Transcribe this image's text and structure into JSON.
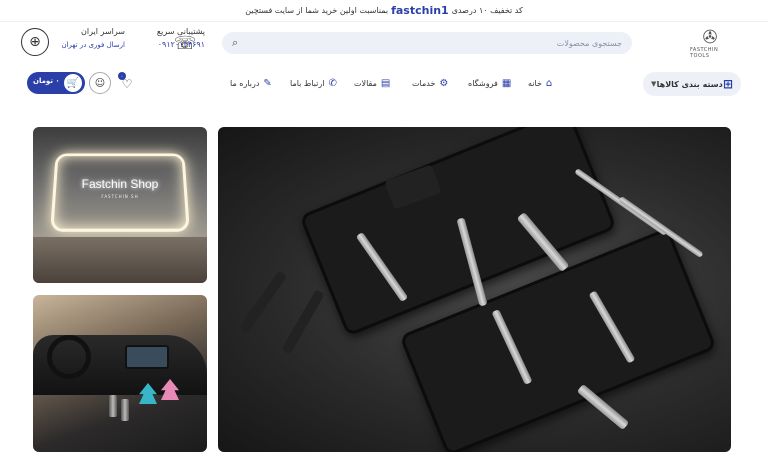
{
  "promo": {
    "text_before": "کد تخفیف ۱۰ درصدی",
    "code": "fastchin1",
    "text_after": "بمناسبت اولین خرید شما از سایت فستچین"
  },
  "logo": {
    "text": "FASTCHIN TOOLS"
  },
  "search": {
    "placeholder": "جستجوی محصولات"
  },
  "support": {
    "title": "پشتیبانی سریع",
    "phone": "۰۹۱۲۰۱۳۴۶۹۱"
  },
  "shipping": {
    "title": "سراسر ایران",
    "subtitle": "ارسال فوری در تهران"
  },
  "nav": {
    "categories_label": "دسته بندی کالاها",
    "items": [
      {
        "label": "خانه",
        "icon": "home-icon"
      },
      {
        "label": "فروشگاه",
        "icon": "store-icon"
      },
      {
        "label": "خدمات",
        "icon": "services-icon"
      },
      {
        "label": "مقالات",
        "icon": "articles-icon"
      },
      {
        "label": "ارتباط باما",
        "icon": "phone-icon"
      },
      {
        "label": "درباره ما",
        "icon": "about-icon"
      }
    ]
  },
  "cart": {
    "price": "۰ تومان",
    "wishlist_count": "۰"
  },
  "banners": {
    "shop_title": "Fastchin Shop",
    "shop_subtitle": "FASTCHIN SH"
  },
  "colors": {
    "accent": "#2b3fa8",
    "search_bg": "#eef0f8"
  }
}
